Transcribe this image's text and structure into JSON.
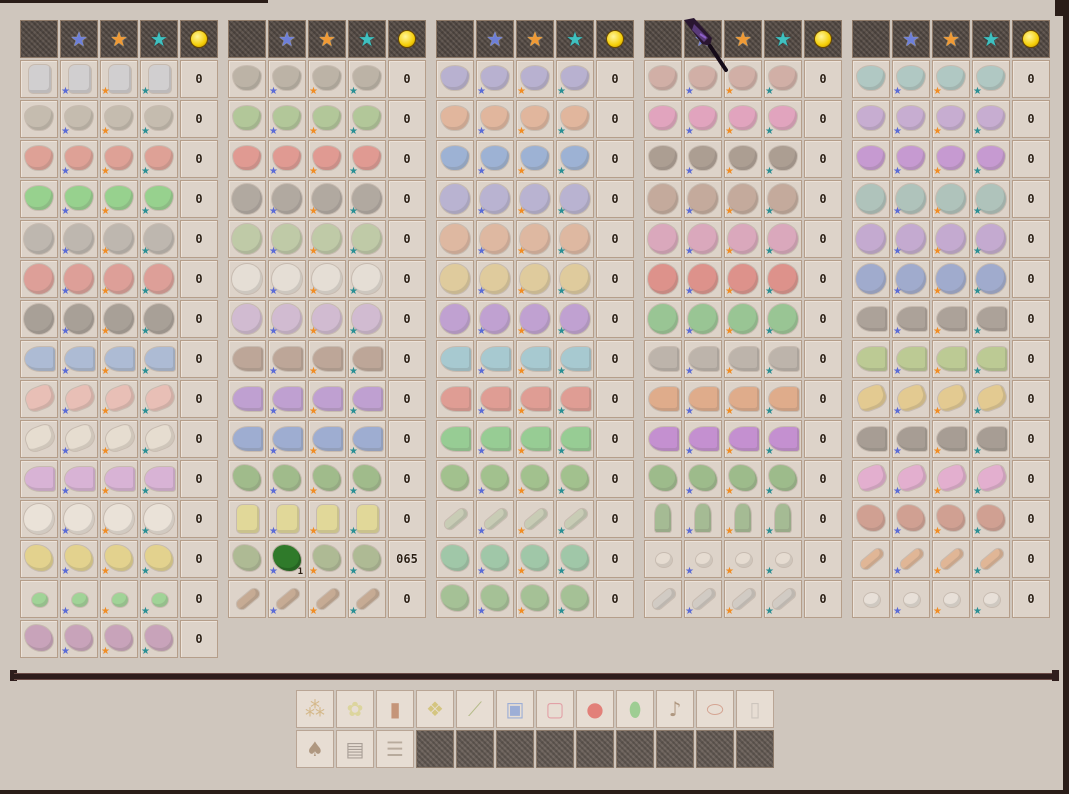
{
  "header_icons": [
    {
      "name": "empty-header-slot",
      "glyph": ""
    },
    {
      "name": "silver-star-icon",
      "glyph": "★",
      "class": "icon-blue"
    },
    {
      "name": "gold-star-icon",
      "glyph": "★",
      "class": "icon-gold"
    },
    {
      "name": "iridium-star-icon",
      "glyph": "★",
      "class": "icon-irid"
    },
    {
      "name": "gold-coin-icon",
      "glyph": "",
      "class": "coin"
    }
  ],
  "quality_markers": {
    "silver": "★",
    "gold": "★",
    "iridium": "★"
  },
  "panels": [
    {
      "rows": [
        {
          "shape": "bottle",
          "color": "#c9ccd6",
          "qty": "0"
        },
        {
          "shape": "bowl",
          "color": "#b3aa9a",
          "qty": "0"
        },
        {
          "shape": "bowl",
          "color": "#e07a6d",
          "qty": "0"
        },
        {
          "shape": "bowl",
          "color": "#5fd05f",
          "qty": "0"
        },
        {
          "shape": "ball",
          "color": "#a5a19b",
          "qty": "0"
        },
        {
          "shape": "ball",
          "color": "#dd7671",
          "qty": "0"
        },
        {
          "shape": "ball",
          "color": "#7e7770",
          "qty": "0"
        },
        {
          "shape": "wedge",
          "color": "#86a9dd",
          "qty": "0"
        },
        {
          "shape": "roll",
          "color": "#f1b0a8",
          "qty": "0"
        },
        {
          "shape": "roll",
          "color": "#efe6d6",
          "qty": "0"
        },
        {
          "shape": "wedge",
          "color": "#d59ae0",
          "qty": "0"
        },
        {
          "shape": "ball",
          "color": "#f5efe6",
          "qty": "0"
        },
        {
          "shape": "leaf",
          "color": "#e8d25e",
          "qty": "0"
        },
        {
          "shape": "dot",
          "color": "#6fd36f",
          "qty": "0"
        },
        {
          "shape": "leaf",
          "color": "#b77cae",
          "qty": "0"
        }
      ]
    },
    {
      "rows": [
        {
          "shape": "bowl",
          "color": "#a29a8a",
          "qty": "0"
        },
        {
          "shape": "bowl",
          "color": "#8fbf72",
          "qty": "0"
        },
        {
          "shape": "bowl",
          "color": "#e36d66",
          "qty": "0"
        },
        {
          "shape": "ball",
          "color": "#8e8780",
          "qty": "0"
        },
        {
          "shape": "ball",
          "color": "#a7c48c",
          "qty": "0"
        },
        {
          "shape": "ball",
          "color": "#ece8e0",
          "qty": "0"
        },
        {
          "shape": "ball",
          "color": "#c9a9d9",
          "qty": "0"
        },
        {
          "shape": "wedge",
          "color": "#a38371",
          "qty": "0"
        },
        {
          "shape": "wedge",
          "color": "#a878d8",
          "qty": "0"
        },
        {
          "shape": "wedge",
          "color": "#6b8fd8",
          "qty": "0"
        },
        {
          "shape": "leaf",
          "color": "#6fa85a",
          "qty": "0"
        },
        {
          "shape": "bottle",
          "color": "#e6dd72",
          "qty": "0"
        },
        {
          "shape": "leaf",
          "color": "#88a66a",
          "qty": "065",
          "special_badge": "1",
          "special_col": 1
        },
        {
          "shape": "log",
          "color": "#b58c6a",
          "qty": "0"
        }
      ]
    },
    {
      "rows": [
        {
          "shape": "bowl",
          "color": "#9b97d6",
          "qty": "0"
        },
        {
          "shape": "bowl",
          "color": "#e6a07a",
          "qty": "0"
        },
        {
          "shape": "bowl",
          "color": "#6a98dd",
          "qty": "0"
        },
        {
          "shape": "ball",
          "color": "#9d9ad9",
          "qty": "0"
        },
        {
          "shape": "ball",
          "color": "#e0a281",
          "qty": "0"
        },
        {
          "shape": "ball",
          "color": "#e1c57a",
          "qty": "0"
        },
        {
          "shape": "ball",
          "color": "#a979d9",
          "qty": "0"
        },
        {
          "shape": "wedge",
          "color": "#7cc1d6",
          "qty": "0"
        },
        {
          "shape": "wedge",
          "color": "#e2726a",
          "qty": "0"
        },
        {
          "shape": "wedge",
          "color": "#5fc76a",
          "qty": "0"
        },
        {
          "shape": "leaf",
          "color": "#73b45e",
          "qty": "0"
        },
        {
          "shape": "log",
          "color": "#b7c8a6",
          "qty": "0"
        },
        {
          "shape": "leaf",
          "color": "#6fbf8e",
          "qty": "0"
        },
        {
          "shape": "leaf",
          "color": "#78b46d",
          "qty": "0"
        }
      ]
    },
    {
      "rows": [
        {
          "shape": "bowl",
          "color": "#c8928a",
          "qty": "0"
        },
        {
          "shape": "bowl",
          "color": "#e67fb6",
          "qty": "0"
        },
        {
          "shape": "bowl",
          "color": "#857366",
          "qty": "0"
        },
        {
          "shape": "ball",
          "color": "#b08a78",
          "qty": "0"
        },
        {
          "shape": "ball",
          "color": "#d885b3",
          "qty": "0"
        },
        {
          "shape": "ball",
          "color": "#dd5e5a",
          "qty": "0"
        },
        {
          "shape": "ball",
          "color": "#62bb6a",
          "qty": "0"
        },
        {
          "shape": "wedge",
          "color": "#a39b94",
          "qty": "0"
        },
        {
          "shape": "wedge",
          "color": "#e28d5a",
          "qty": "0"
        },
        {
          "shape": "wedge",
          "color": "#b05ad7",
          "qty": "0"
        },
        {
          "shape": "leaf",
          "color": "#6aa95a",
          "qty": "0"
        },
        {
          "shape": "palm",
          "color": "#78a86a",
          "qty": "0"
        },
        {
          "shape": "dot",
          "color": "#eee4d8",
          "qty": "0"
        },
        {
          "shape": "log",
          "color": "#c9c5c0",
          "qty": "0"
        }
      ]
    },
    {
      "rows": [
        {
          "shape": "bowl",
          "color": "#8cc0bf",
          "qty": "0"
        },
        {
          "shape": "bowl",
          "color": "#b68fd9",
          "qty": "0"
        },
        {
          "shape": "bowl",
          "color": "#b46dd8",
          "qty": "0"
        },
        {
          "shape": "ball",
          "color": "#8ab6b0",
          "qty": "0"
        },
        {
          "shape": "ball",
          "color": "#b08ad6",
          "qty": "0"
        },
        {
          "shape": "ball",
          "color": "#6f8cd2",
          "qty": "0"
        },
        {
          "shape": "wedge",
          "color": "#857b72",
          "qty": "0"
        },
        {
          "shape": "wedge",
          "color": "#a2c46a",
          "qty": "0"
        },
        {
          "shape": "roll",
          "color": "#e8c465",
          "qty": "0"
        },
        {
          "shape": "wedge",
          "color": "#7b726a",
          "qty": "0"
        },
        {
          "shape": "roll",
          "color": "#e892d5",
          "qty": "0"
        },
        {
          "shape": "leaf",
          "color": "#c77866",
          "qty": "0"
        },
        {
          "shape": "log",
          "color": "#e3a06e",
          "qty": "0"
        },
        {
          "shape": "dot",
          "color": "#f1ece6",
          "qty": "0"
        }
      ]
    }
  ],
  "bottom_row1": [
    {
      "name": "hay-item-icon",
      "glyph": "⁂",
      "color": "#c9a05a"
    },
    {
      "name": "fiber-item-icon",
      "glyph": "✿",
      "color": "#d6d07a"
    },
    {
      "name": "barrel-item-icon",
      "glyph": "▮",
      "color": "#b0663e"
    },
    {
      "name": "seed-packet-item-icon",
      "glyph": "❖",
      "color": "#c9b64a"
    },
    {
      "name": "branch-item-icon",
      "glyph": "⟋",
      "color": "#96a65a"
    },
    {
      "name": "blue-packet-item-icon",
      "glyph": "▣",
      "color": "#6d8fd8"
    },
    {
      "name": "pink-packet-item-icon",
      "glyph": "▢",
      "color": "#e07a8a"
    },
    {
      "name": "red-berry-item-icon",
      "glyph": "●",
      "color": "#e0443f"
    },
    {
      "name": "green-pod-item-icon",
      "glyph": "⬮",
      "color": "#6fc46a"
    },
    {
      "name": "guitar-item-icon",
      "glyph": "♪",
      "color": "#8a6a4a"
    },
    {
      "name": "jar-item-icon",
      "glyph": "⬭",
      "color": "#c9806a"
    },
    {
      "name": "milk-bottle-item-icon",
      "glyph": "▯",
      "color": "#bcb6b0"
    }
  ],
  "bottom_row2": [
    {
      "name": "acorn-item-icon",
      "glyph": "♠",
      "color": "#8a6a4a"
    },
    {
      "name": "box-item-icon",
      "glyph": "▤",
      "color": "#807670"
    },
    {
      "name": "ladder-item-icon",
      "glyph": "☰",
      "color": "#9a8a7a"
    },
    {
      "name": "empty-slot",
      "glyph": ""
    },
    {
      "name": "empty-slot",
      "glyph": ""
    },
    {
      "name": "empty-slot",
      "glyph": ""
    },
    {
      "name": "empty-slot",
      "glyph": ""
    },
    {
      "name": "empty-slot",
      "glyph": ""
    },
    {
      "name": "empty-slot",
      "glyph": ""
    },
    {
      "name": "empty-slot",
      "glyph": ""
    },
    {
      "name": "empty-slot",
      "glyph": ""
    },
    {
      "name": "empty-slot",
      "glyph": ""
    }
  ]
}
